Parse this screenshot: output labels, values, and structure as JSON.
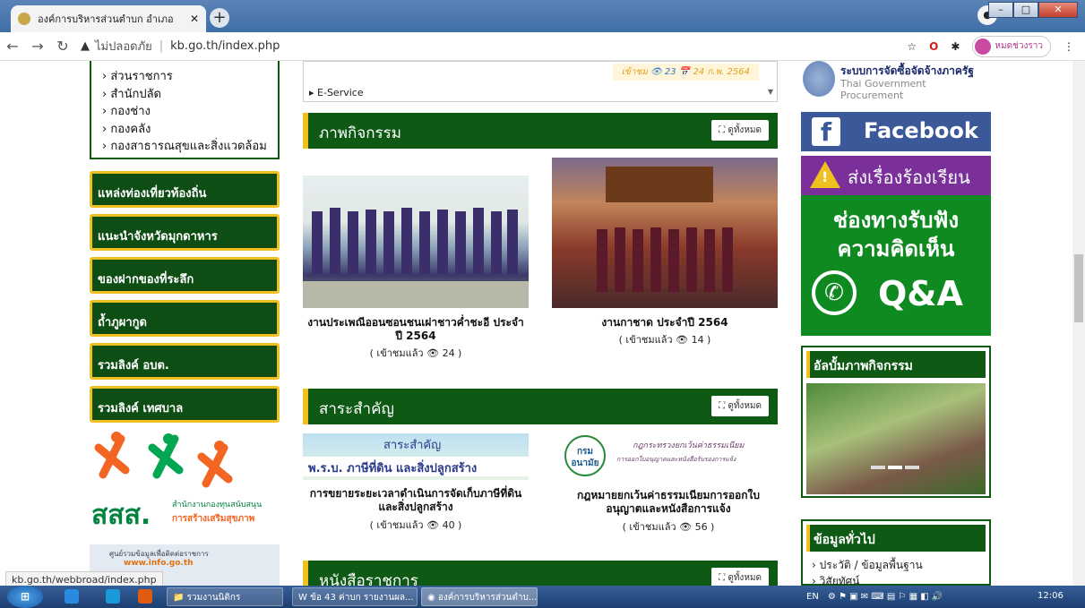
{
  "browser": {
    "tab_title": "องค์การบริหารส่วนตำบก อำเภอ",
    "address_insecure": "ไม่ปลอดภัย",
    "address_url": "kb.go.th/index.php",
    "profile_label": "หมดช่วงราว",
    "status_url": "kb.go.th/webbroad/index.php"
  },
  "left": {
    "departments": [
      "ส่วนราชการ",
      "สำนักปลัด",
      "กองช่าง",
      "กองคลัง",
      "กองสาธารณสุขและสิ่งแวดล้อม"
    ],
    "menu": [
      "แหล่งท่องเที่ยวท้องถิ่น",
      "แนะนำจังหวัดมุกดาหาร",
      "ของฝากของที่ระลึก",
      "ถ้ำภูผากูด",
      "รวมลิงค์ อบต.",
      "รวมลิงค์ เทศบาล"
    ],
    "sss_title": "สสส.",
    "sss_line1": "สำนักงานกองทุนสนับสนุน",
    "sss_line2": "การสร้างเสริมสุขภาพ",
    "info_line1": "ศูนย์รวมข้อมูลเพื่อติดต่อราชการ",
    "info_line2": "www.info.go.th"
  },
  "center": {
    "views_label": "เข้าชม",
    "views_count": "23",
    "date": "24 ก.พ. 2564",
    "eservice": "E-Service",
    "see_all": "ดูทั้งหมด",
    "activities_title": "ภาพกิจกรรม",
    "activities": [
      {
        "caption": "งานประเพณีออนซอนชนเผ่าชาวค่ำชะอี ประจำปี 2564",
        "views": "( เข้าชมแล้ว 👁 24 )"
      },
      {
        "caption": "งานกาชาด ประจำปี 2564",
        "views": "( เข้าชมแล้ว 👁 14 )"
      }
    ],
    "important_title": "สาระสำคัญ",
    "important": [
      {
        "caption": "การขยายระยะเวลาดำเนินการจัดเก็บภาษีที่ดินและสิ่งปลูกสร้าง",
        "views": "( เข้าชมแล้ว 👁 40 )",
        "banner_a": "สาระสำคัญ",
        "banner_b": "พ.ร.บ. ภาษีที่ดิน และสิ่งปลูกสร้าง"
      },
      {
        "caption": "กฎหมายยกเว้นค่าธรรมเนียมการออกใบอนุญาตและหนังสือการแจ้ง",
        "views": "( เข้าชมแล้ว 👁 56 )",
        "banner_a": "กฎกระทรวงยกเว้นค่าธรรมเนียม",
        "banner_b": "การออกใบอนุญาตและหนังสือรับรองการแจ้ง",
        "logo": "กรม อนามัย"
      }
    ],
    "documents_title": "หนังสือราชการ"
  },
  "right": {
    "procure_th": "ระบบการจัดซื้อจัดจ้างภาครัฐ",
    "procure_en": "Thai Government Procurement",
    "facebook": "Facebook",
    "complain": "ส่งเรื่องร้องเรียน",
    "qa_line1": "ช่องทางรับฟัง",
    "qa_line2": "ความคิดเห็น",
    "qa": "Q&A",
    "album_title": "อัลบั้มภาพกิจกรรม",
    "general_title": "ข้อมูลทั่วไป",
    "general_items": [
      "ประวัติ / ข้อมูลพื้นฐาน",
      "วิสัยทัศน์"
    ]
  },
  "taskbar": {
    "items": [
      "รวมงานนิติกร",
      "ข้อ 43 ค่าบก รายงานผล...",
      "องค์การบริหารส่วนตำบ..."
    ],
    "lang": "EN",
    "clock": "12:06"
  },
  "colors": {
    "green": "#0e5a15",
    "gold": "#f0c020",
    "facebook": "#3b5998",
    "purple": "#7a2f9a"
  }
}
